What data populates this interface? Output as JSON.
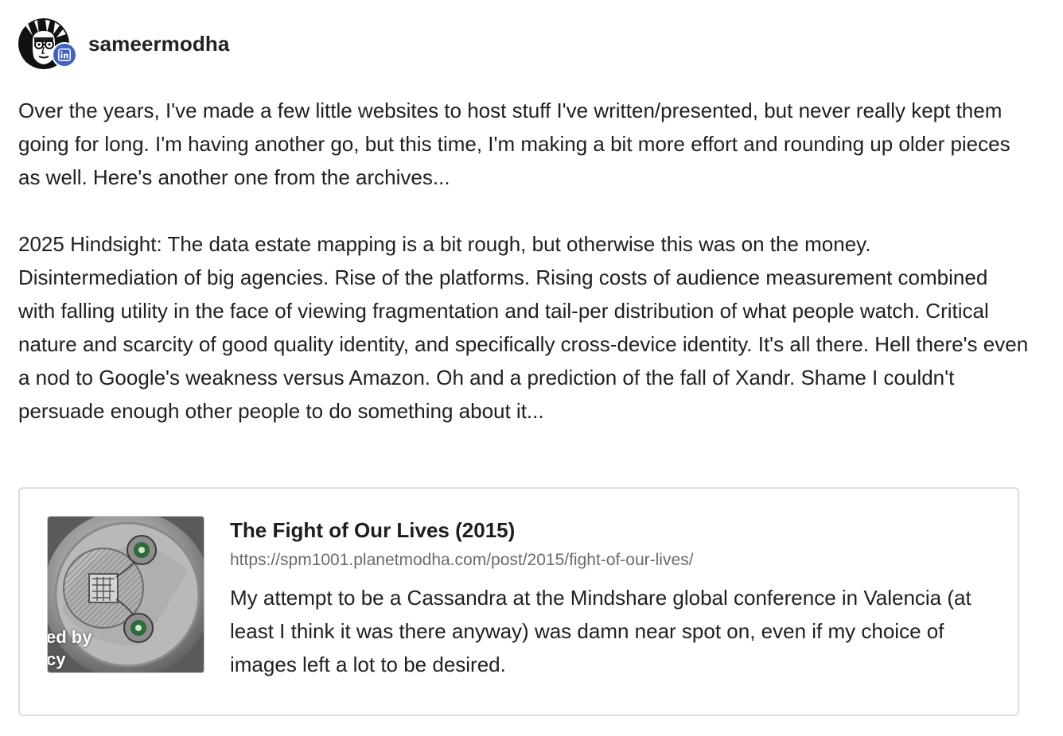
{
  "author": {
    "username": "sameermodha",
    "platform_icon": "linkedin-icon",
    "badge_color": "#3f63c0"
  },
  "post": {
    "paragraphs": [
      "Over the years, I've made a few little websites to host stuff I've written/presented, but never really kept them going for long. I'm having another go, but this time, I'm making a bit more effort and rounding up older pieces as well. Here's another one from the archives...",
      "2025 Hindsight: The data estate mapping is a bit rough, but otherwise this was on the money. Disintermediation of big agencies. Rise of the platforms. Rising costs of audience measurement combined with falling utility in the face of viewing fragmentation and tail-per distribution of what people watch. Critical nature and scarcity of good quality identity, and specifically cross-device identity. It's all there. Hell there's even a nod to Google's weakness versus Amazon. Oh and a prediction of the fall of Xandr. Shame I couldn't persuade enough other people to do something about it..."
    ]
  },
  "link_card": {
    "title": "The Fight of Our Lives (2015)",
    "url": "https://spm1001.planetmodha.com/post/2015/fight-of-our-lives/",
    "description": "My attempt to be a Cassandra at the Mindshare global conference in Valencia (at least I think it was there anyway) was damn near spot on, even if my choice of images left a lot to be desired.",
    "thumbnail_overlay_lines": [
      "ed by",
      "cy"
    ]
  }
}
